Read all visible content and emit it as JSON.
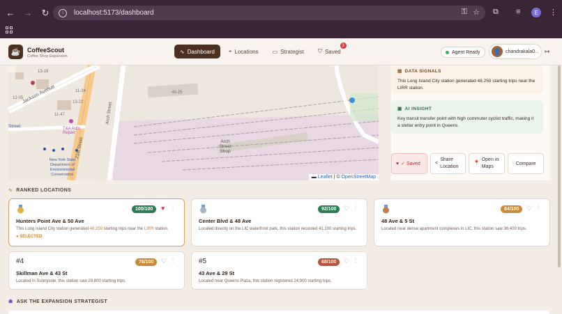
{
  "browser": {
    "url": "localhost:5173/dashboard",
    "profile_initial": "E"
  },
  "header": {
    "logo": "☕",
    "app_name": "CoffeeScout",
    "app_subtitle": "Coffee Shop Expansion",
    "nav": [
      {
        "label": "Dashboard",
        "icon": "activity-icon"
      },
      {
        "label": "Locations",
        "icon": "pin-icon"
      },
      {
        "label": "Strategist",
        "icon": "chat-icon"
      },
      {
        "label": "Saved",
        "icon": "bookmark-icon",
        "badge": "3"
      }
    ],
    "agent_status": "Agent Ready",
    "user_initial": "👤",
    "user_name": "chandrakala0..."
  },
  "map": {
    "labels": [
      "Jackson Avenue",
      "21st Street",
      "Arch Street",
      "Arch Street Shop",
      "T&A Auto Repair",
      "New York State Department of Environmental Conservation",
      "Street",
      "46-25",
      "13-19",
      "11-47",
      "11-24",
      "13-22",
      "12-05"
    ],
    "attribution_leaflet": "Leaflet",
    "attribution_sep": "| ©",
    "attribution_osm": "OpenStreetMap"
  },
  "panel": {
    "signals_title": "DATA SIGNALS",
    "signals_body": "This Long Island City station generated 48,250 starting trips near the LIRR station.",
    "insight_title": "AI INSIGHT",
    "insight_body": "Key transit transfer point with high commuter cyclist traffic, making it a stellar entry point in Queens.",
    "actions": {
      "saved": "✓ Saved",
      "share": "Share Location",
      "maps": "Open in Maps",
      "compare": "Compare"
    }
  },
  "ranked": {
    "title": "RANKED LOCATIONS",
    "items": [
      {
        "rank": "1",
        "score": "100/100",
        "name": "Hunters Point Ave & 50 Ave",
        "desc_pre": "This Long Island City station generated ",
        "desc_num": "48,250",
        "desc_mid": " starting trips near the ",
        "desc_link": "LIRR",
        "desc_post": " station.",
        "selected": "SELECTED",
        "color": "#2e7a52"
      },
      {
        "rank": "2",
        "score": "92/100",
        "name": "Center Blvd & 48 Ave",
        "desc": "Located directly on the LIC waterfront park, this station recorded 41,100 starting trips.",
        "color": "#2e7a52"
      },
      {
        "rank": "3",
        "score": "84/100",
        "name": "48 Ave & 5 St",
        "desc": "Located near dense apartment complexes in LIC, this station saw 36,400 trips.",
        "color": "#c88a3c"
      },
      {
        "rank": "#4",
        "score": "76/100",
        "name": "Skillman Ave & 43 St",
        "desc": "Located in Sunnyside, this station saw 29,800 starting trips.",
        "color": "#c88a3c"
      },
      {
        "rank": "#5",
        "score": "68/100",
        "name": "43 Ave & 29 St",
        "desc": "Located near Queens Plaza, this station registered 24,900 starting trips.",
        "color": "#b4553c"
      }
    ]
  },
  "strategist": {
    "title": "ASK THE EXPANSION STRATEGIST"
  }
}
